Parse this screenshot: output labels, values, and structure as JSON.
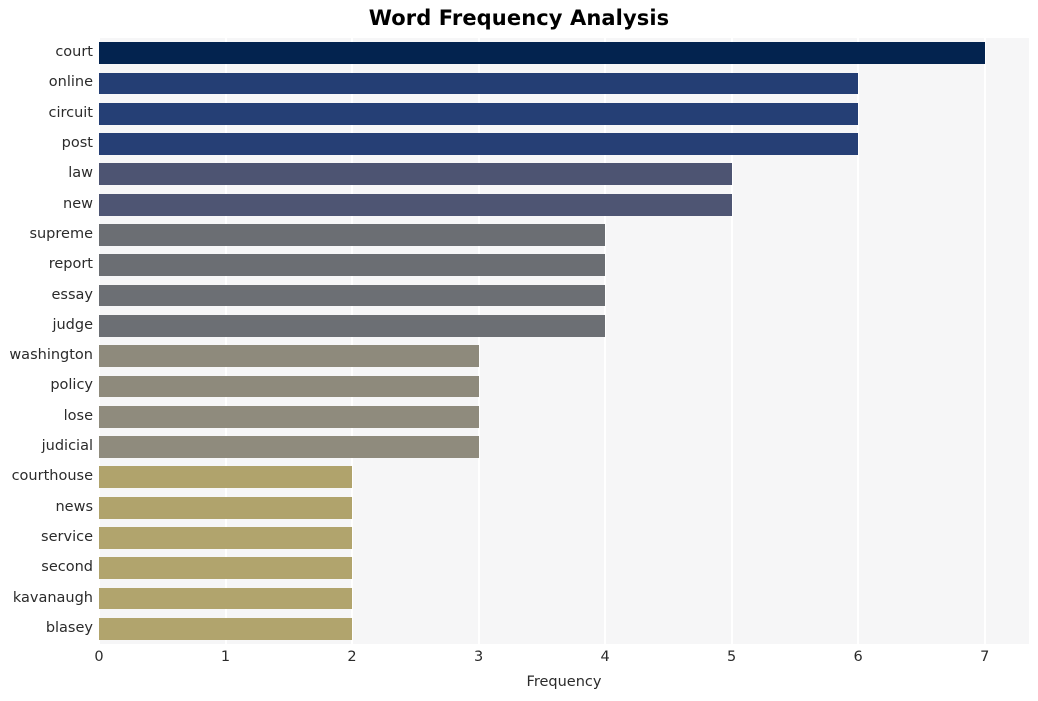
{
  "chart_data": {
    "type": "bar",
    "orientation": "horizontal",
    "title": "Word Frequency Analysis",
    "xlabel": "Frequency",
    "ylabel": "",
    "categories": [
      "court",
      "online",
      "circuit",
      "post",
      "law",
      "new",
      "supreme",
      "report",
      "essay",
      "judge",
      "washington",
      "policy",
      "lose",
      "judicial",
      "courthouse",
      "news",
      "service",
      "second",
      "kavanaugh",
      "blasey"
    ],
    "values": [
      7,
      6,
      6,
      6,
      5,
      5,
      4,
      4,
      4,
      4,
      3,
      3,
      3,
      3,
      2,
      2,
      2,
      2,
      2,
      2
    ],
    "bar_colors": [
      "#03234f",
      "#243e74",
      "#253f75",
      "#263f75",
      "#4d5472",
      "#4e5573",
      "#6b6e73",
      "#6b6e73",
      "#6c6f74",
      "#6c6f74",
      "#8e8a7c",
      "#8e8a7c",
      "#8f8b7d",
      "#8f8b7d",
      "#b0a36c",
      "#b0a36c",
      "#b1a46d",
      "#b1a46d",
      "#b1a46d",
      "#b1a46d"
    ],
    "xlim": [
      0,
      7.35
    ],
    "xticks": [
      0,
      1,
      2,
      3,
      4,
      5,
      6,
      7
    ],
    "xticklabels": [
      "0",
      "1",
      "2",
      "3",
      "4",
      "5",
      "6",
      "7"
    ],
    "grid": true,
    "grid_axis": "x",
    "grid_color": "#ffffff",
    "plot_background": "#f6f6f7",
    "figure_background": "#ffffff",
    "legend": null
  }
}
